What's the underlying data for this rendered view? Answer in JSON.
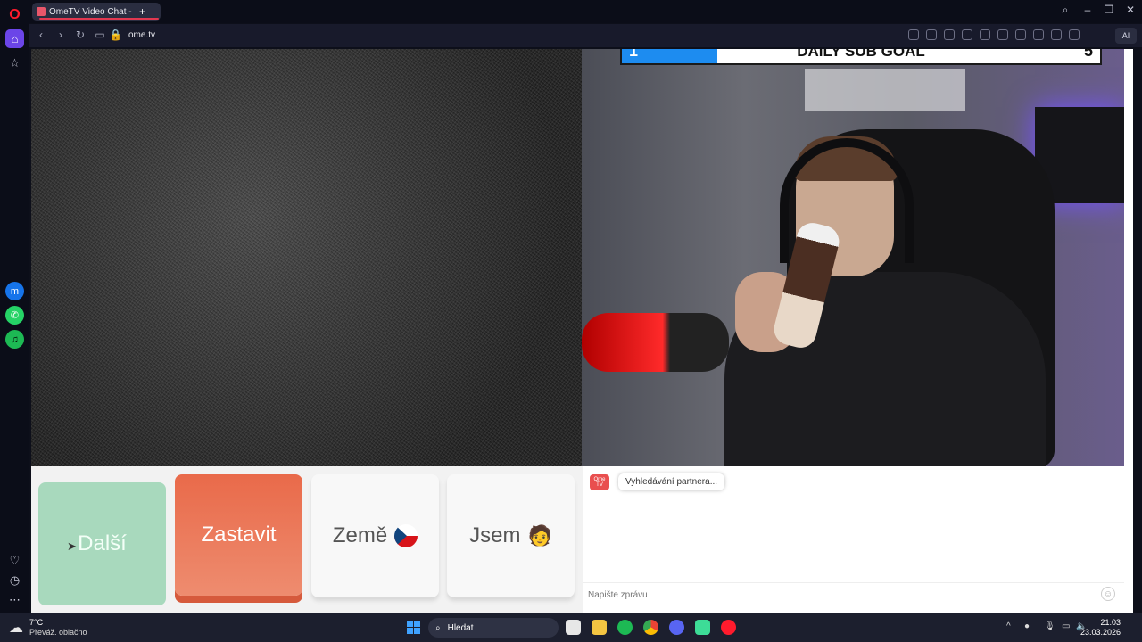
{
  "browser": {
    "tab_title": "OmeTV Video Chat -",
    "new_tab": "+",
    "url": "ome.tv",
    "ai_label": "AI",
    "window_controls": {
      "search": "⌕",
      "minimize": "–",
      "restore": "❐",
      "close": "✕"
    }
  },
  "sidebar": {
    "opera": "O",
    "home": "⌂",
    "bookmarks": "☆",
    "messenger": "m",
    "whatsapp": "✆",
    "spotify": "♫",
    "heart": "♡",
    "history": "◷",
    "more": "⋯"
  },
  "stream_overlay": {
    "goal_title": "DAILY SUB GOAL",
    "current": "1",
    "target": "5",
    "progress": 0.2,
    "accent": "#1d8cf0"
  },
  "controls": {
    "next_label": "Další",
    "stop_label": "Zastavit",
    "country_label": "Země",
    "gender_label": "Jsem",
    "gender_emoji": "🧑",
    "stop_color": "#e96a4a",
    "next_color": "#a8d9bd"
  },
  "chat": {
    "logo_text": "Ome TV",
    "status_message": "Vyhledávání partnera...",
    "input_placeholder": "Napište zprávu",
    "emoji": "☺"
  },
  "taskbar": {
    "weather_temp": "7°C",
    "weather_desc": "Převáž. oblačno",
    "search_label": "Hledat",
    "search_icon": "⌕",
    "time": "21:03",
    "date": "23.03.2026"
  }
}
